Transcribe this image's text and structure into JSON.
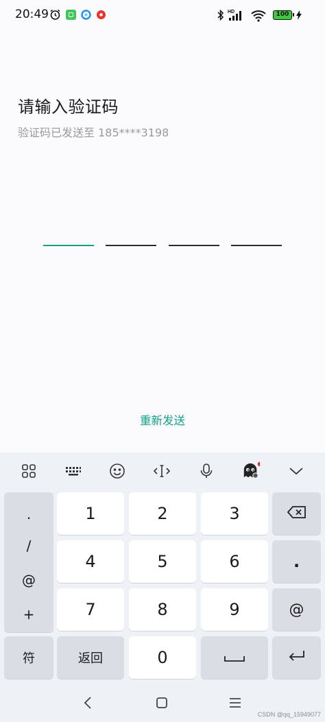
{
  "status_bar": {
    "time": "20:49",
    "battery_level": "100",
    "network_badge": "HD",
    "icons": [
      "alarm-icon",
      "app-green-icon",
      "app-blue-icon",
      "app-red-icon",
      "bluetooth-icon",
      "signal-icon",
      "wifi-icon",
      "battery-icon",
      "charging-icon"
    ]
  },
  "main": {
    "title": "请输入验证码",
    "subtitle": "验证码已发送至 185****3198",
    "code_slots": [
      "",
      "",
      "",
      ""
    ],
    "resend_label": "重新发送"
  },
  "keyboard": {
    "toolbar_icons": [
      "grid-icon",
      "keyboard-icon",
      "emoji-icon",
      "cursor-icon",
      "microphone-icon",
      "ghost-skin-icon",
      "chevron-down-icon"
    ],
    "symbols": [
      ".",
      "/",
      "@",
      "+"
    ],
    "keys": {
      "k1": "1",
      "k2": "2",
      "k3": "3",
      "k4": "4",
      "k5": "5",
      "k6": "6",
      "k7": "7",
      "k8": "8",
      "k9": "9",
      "k0": "0",
      "dot": ".",
      "at": "@",
      "symbols": "符",
      "back": "返回"
    }
  },
  "nav_bar": {
    "icons": [
      "back-icon",
      "home-icon",
      "menu-icon"
    ]
  },
  "watermark": "CSDN @qq_15949077",
  "colors": {
    "accent": "#13a08a",
    "background": "#fbfafd",
    "keyboard_bg": "#eef1f5",
    "key_white": "#ffffff",
    "key_gray": "#dadde3"
  }
}
